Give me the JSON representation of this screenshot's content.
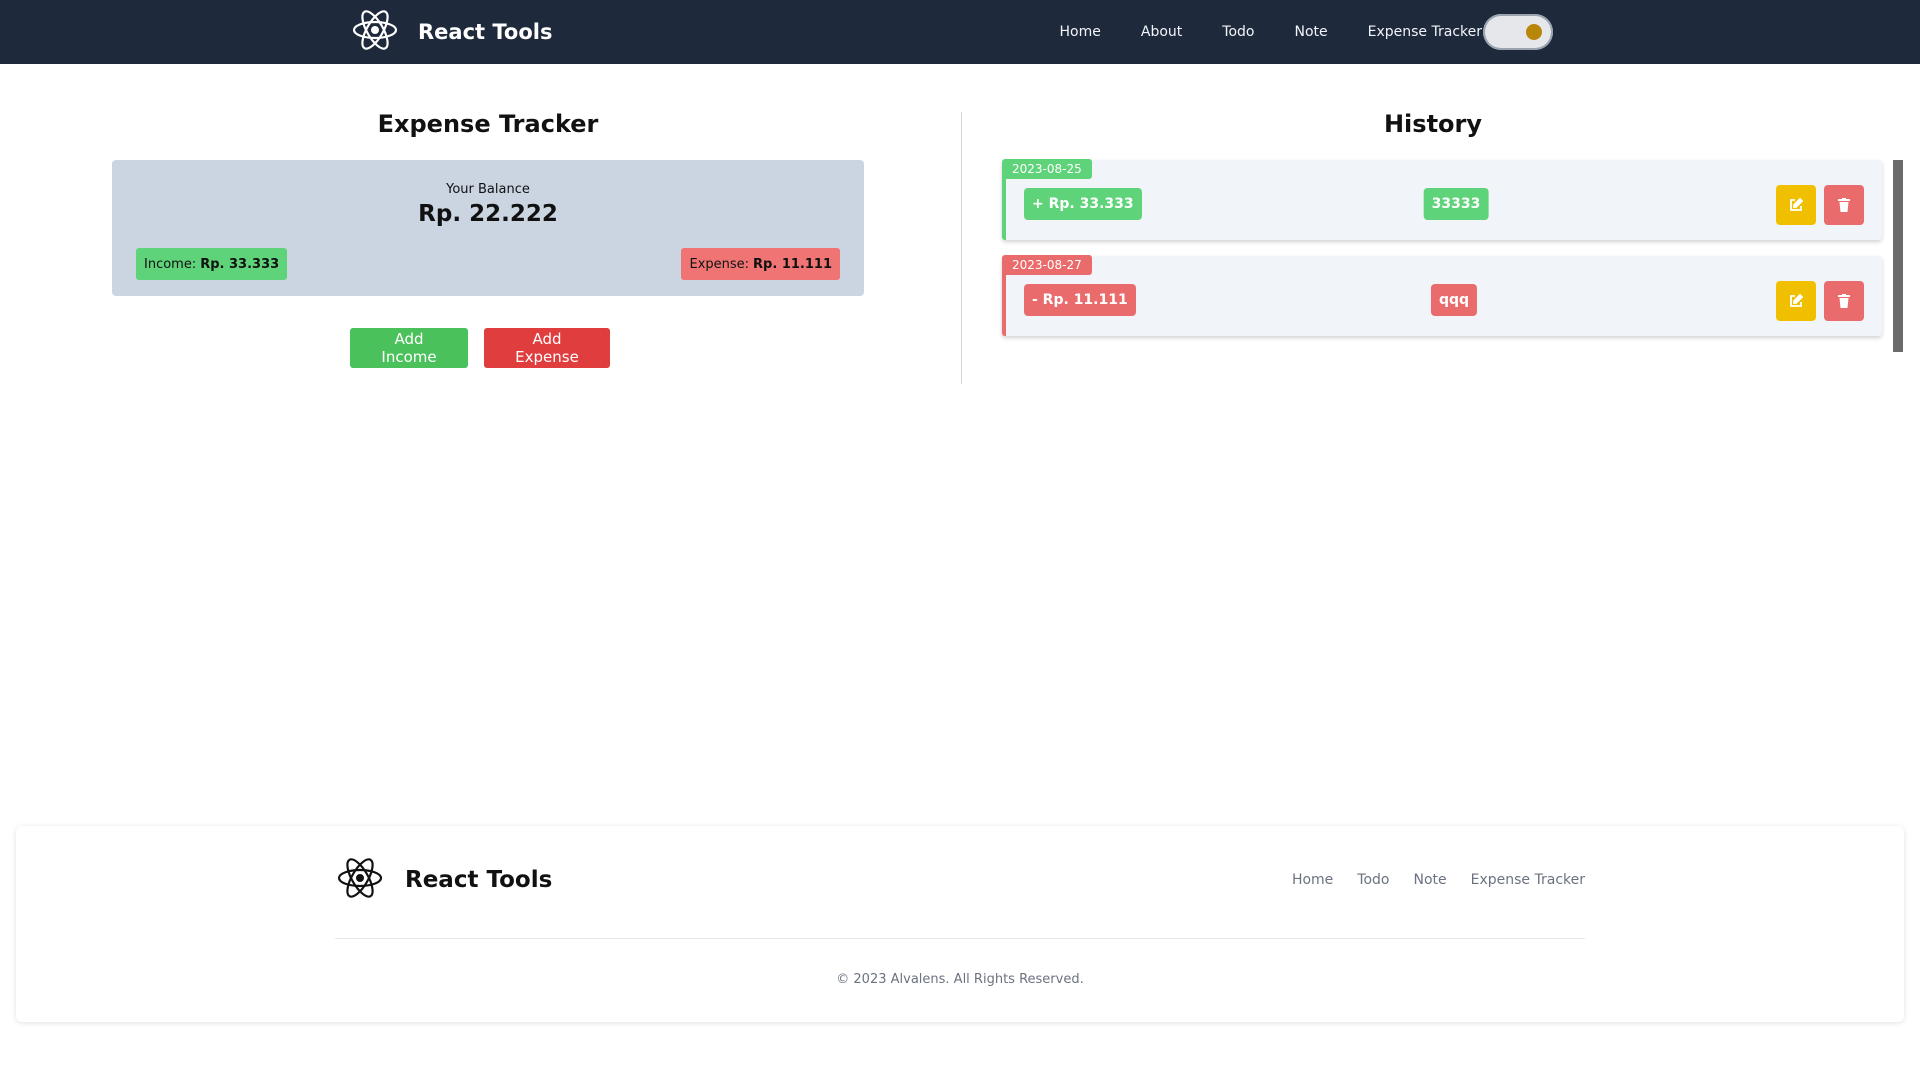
{
  "navbar": {
    "brand": "React Tools",
    "links": [
      "Home",
      "About",
      "Todo",
      "Note",
      "Expense Tracker"
    ],
    "theme_toggle_icon": "toggle-switch-icon"
  },
  "tracker": {
    "title": "Expense Tracker",
    "balance_label": "Your Balance",
    "balance_value": "Rp. 22.222",
    "income_label": "Income:",
    "income_value": "Rp. 33.333",
    "expense_label": "Expense:",
    "expense_value": "Rp. 11.111",
    "add_income": "Add Income",
    "add_expense": "Add Expense"
  },
  "history": {
    "title": "History",
    "items": [
      {
        "date": "2023-08-25",
        "amount": "+ Rp. 33.333",
        "description": "33333",
        "type": "income"
      },
      {
        "date": "2023-08-27",
        "amount": "- Rp. 11.111",
        "description": "qqq",
        "type": "expense"
      }
    ],
    "edit_icon": "edit-icon",
    "delete_icon": "trash-icon"
  },
  "footer": {
    "brand": "React Tools",
    "links": [
      "Home",
      "Todo",
      "Note",
      "Expense Tracker"
    ],
    "copyright": "© 2023 Alvalens. All Rights Reserved."
  },
  "colors": {
    "navbar_bg": "#1e293b",
    "income_green": "#5fd37a",
    "expense_red": "#ea6b6b",
    "edit_yellow": "#f0c000",
    "card_bg": "#cbd5e1"
  }
}
